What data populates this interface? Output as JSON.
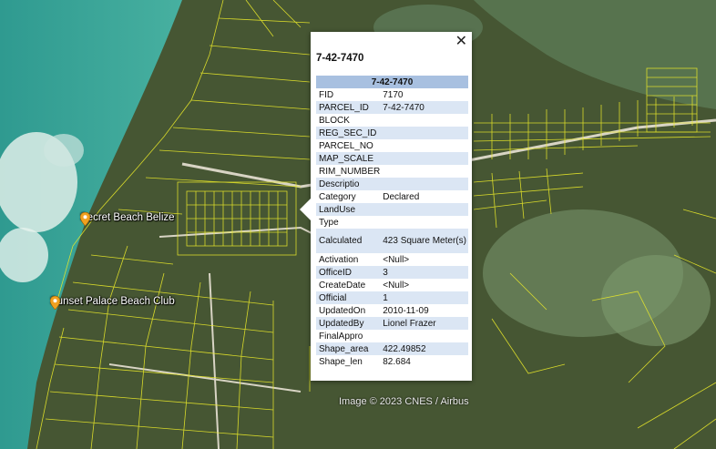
{
  "map": {
    "places": [
      {
        "name": "Secret Beach Belize"
      },
      {
        "name": "Sunset Palace Beach Club"
      }
    ],
    "attribution": "Image © 2023 CNES / Airbus",
    "colors": {
      "sea": "#3fa89a",
      "land": "#4a5a32",
      "parcel_lines": "#e8e82a"
    }
  },
  "popup": {
    "title": "7-42-7470",
    "table_header": "7-42-7470",
    "close_icon": "close-icon",
    "rows": [
      {
        "key": "FID",
        "value": "7170"
      },
      {
        "key": "PARCEL_ID",
        "value": "7-42-7470"
      },
      {
        "key": "BLOCK",
        "value": ""
      },
      {
        "key": "REG_SEC_ID",
        "value": ""
      },
      {
        "key": "PARCEL_NO",
        "value": ""
      },
      {
        "key": "MAP_SCALE",
        "value": ""
      },
      {
        "key": "RIM_NUMBER",
        "value": ""
      },
      {
        "key": "Descriptio",
        "value": ""
      },
      {
        "key": "Category",
        "value": "Declared"
      },
      {
        "key": "LandUse",
        "value": ""
      },
      {
        "key": "Type",
        "value": ""
      },
      {
        "key": "Calculated",
        "value": "423 Square Meter(s)"
      },
      {
        "key": "Activation",
        "value": "<Null>"
      },
      {
        "key": "OfficeID",
        "value": "3"
      },
      {
        "key": "CreateDate",
        "value": "<Null>"
      },
      {
        "key": "Official",
        "value": "1"
      },
      {
        "key": "UpdatedOn",
        "value": "2010-11-09"
      },
      {
        "key": "UpdatedBy",
        "value": "Lionel Frazer"
      },
      {
        "key": "FinalAppro",
        "value": ""
      },
      {
        "key": "Shape_area",
        "value": "422.49852"
      },
      {
        "key": "Shape_len",
        "value": "82.684"
      }
    ]
  }
}
